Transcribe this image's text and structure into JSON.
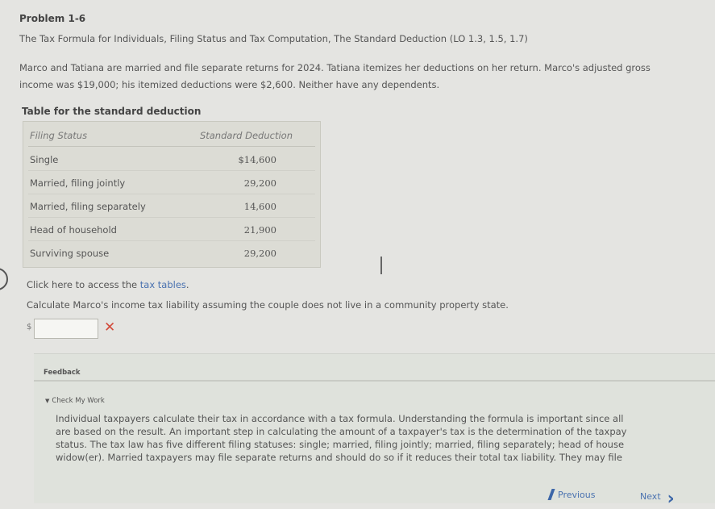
{
  "problem": {
    "title": "Problem 1-6",
    "subtitle": "The Tax Formula for Individuals, Filing Status and Tax Computation, The Standard Deduction (LO 1.3, 1.5, 1.7)",
    "text": "Marco and Tatiana are married and file separate returns for 2024. Tatiana itemizes her deductions on her return. Marco's adjusted gross income was $19,000; his itemized deductions were $2,600. Neither have any dependents."
  },
  "standard_table": {
    "title": "Table for the standard deduction",
    "headers": [
      "Filing Status",
      "Standard Deduction"
    ],
    "rows": [
      {
        "status": "Single",
        "deduction": "$14,600"
      },
      {
        "status": "Married, filing jointly",
        "deduction": "29,200"
      },
      {
        "status": "Married, filing separately",
        "deduction": "14,600"
      },
      {
        "status": "Head of household",
        "deduction": "21,900"
      },
      {
        "status": "Surviving spouse",
        "deduction": "29,200"
      }
    ]
  },
  "tax_tables_link": {
    "prefix": "Click here to access the",
    "link_text": "tax tables",
    "suffix": "."
  },
  "question": {
    "text": "Calculate Marco's income tax liability assuming the couple does not live in a community property state.",
    "currency_symbol": "$",
    "answer_value": "",
    "status_icon": "x-icon",
    "status_glyph": "✕",
    "status_color": "#d24a3a"
  },
  "feedback": {
    "label": "Feedback",
    "check_label": "Check My Work",
    "text": "Individual taxpayers calculate their tax in accordance with a tax formula. Understanding the formula is important since all\nare based on the result. An important step in calculating the amount of a taxpayer's tax is the determination of the taxpay\nstatus. The tax law has five different filing statuses: single; married, filing jointly; married, filing separately; head of house\nwidow(er). Married taxpayers may file separate returns and should do so if it reduces their total tax liability. They may file"
  },
  "navigation": {
    "previous_label": "Previous",
    "next_label": "Next"
  }
}
